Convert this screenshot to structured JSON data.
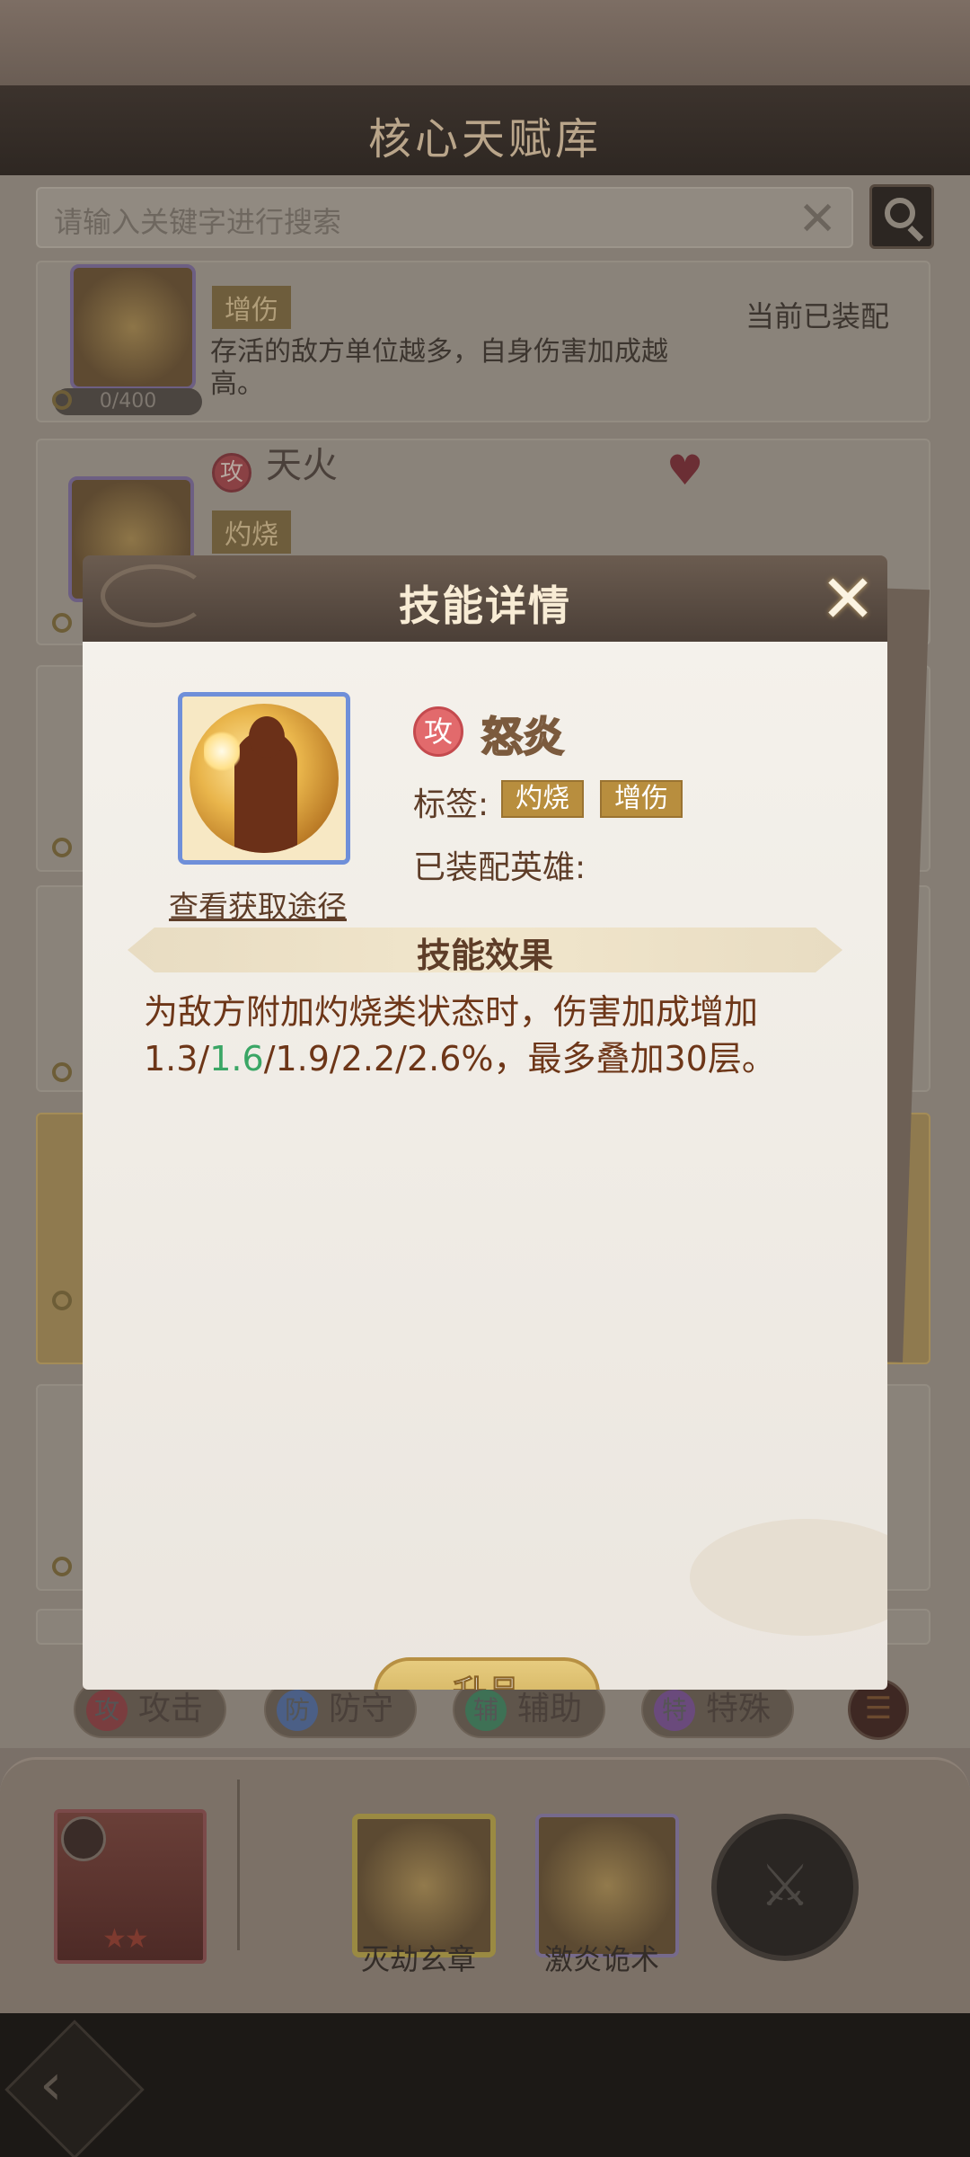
{
  "screen": {
    "title": "核心天赋库"
  },
  "search": {
    "placeholder": "请输入关键字进行搜索"
  },
  "list": {
    "card1": {
      "tag": "增伤",
      "status": "当前已装配",
      "description": "存活的敌方单位越多，自身伤害加成越高。",
      "progress": "0/400"
    },
    "card2": {
      "type_badge": "攻",
      "name": "天火",
      "tag": "灼烧"
    }
  },
  "filters": [
    {
      "badge": "攻",
      "label": "攻击"
    },
    {
      "badge": "防",
      "label": "防守"
    },
    {
      "badge": "辅",
      "label": "辅助"
    },
    {
      "badge": "特",
      "label": "特殊"
    }
  ],
  "dock": {
    "slots": [
      {
        "name": "灭劫玄章"
      },
      {
        "name": "激炎诡术"
      }
    ]
  },
  "modal": {
    "title": "技能详情",
    "skill": {
      "type_badge": "攻",
      "name": "怒炎",
      "tags_label": "标签:",
      "tags": [
        "灼烧",
        "增伤"
      ],
      "hero_label": "已装配英雄:",
      "source_link": "查看获取途径"
    },
    "effect": {
      "title": "技能效果",
      "text_before": "为敌方附加灼烧类状态时，伤害加成增加1.3/",
      "text_highlight": "1.6",
      "text_after": "/1.9/2.2/2.6%，最多叠加30层。"
    },
    "upgrade_label": "升品"
  },
  "colors": {
    "highlight": "#3aa665",
    "accent_gold": "#c9a752",
    "attack_badge": "#e26a6c"
  }
}
